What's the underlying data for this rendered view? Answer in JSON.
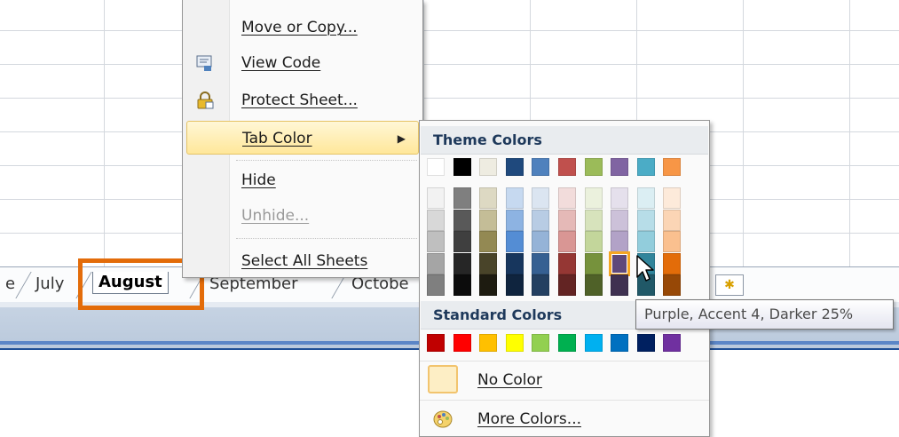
{
  "sheet_tabs": {
    "left_partial": "e",
    "july": "July",
    "august": "August",
    "september": "September",
    "october": "Octobe"
  },
  "context_menu": {
    "items": [
      {
        "label": "Move or Copy...",
        "icon": "",
        "state": "normal"
      },
      {
        "label": "View Code",
        "icon": "view-code-icon",
        "state": "normal"
      },
      {
        "label": "Protect Sheet...",
        "icon": "protect-sheet-icon",
        "state": "normal"
      },
      {
        "label": "Tab Color",
        "icon": "",
        "state": "highlighted",
        "submenu_arrow": "▶"
      },
      {
        "label": "Hide",
        "icon": "",
        "state": "normal"
      },
      {
        "label": "Unhide...",
        "icon": "",
        "state": "disabled"
      },
      {
        "label": "Select All Sheets",
        "icon": "",
        "state": "normal"
      }
    ]
  },
  "palette": {
    "theme_header": "Theme Colors",
    "standard_header": "Standard Colors",
    "theme_base": [
      "#ffffff",
      "#000000",
      "#eeece1",
      "#1f497d",
      "#4f81bd",
      "#c0504d",
      "#9bbb59",
      "#8064a2",
      "#4bacc6",
      "#f79646"
    ],
    "theme_shades": [
      [
        "#f2f2f2",
        "#7f7f7f",
        "#ddd9c3",
        "#c6d9f0",
        "#dbe5f1",
        "#f2dcdb",
        "#ebf1dd",
        "#e5e0ec",
        "#dbeef3",
        "#fdeada"
      ],
      [
        "#d8d8d8",
        "#595959",
        "#c4bd97",
        "#8db3e2",
        "#b8cce4",
        "#e5b9b7",
        "#d7e3bc",
        "#ccc1d9",
        "#b7dde8",
        "#fbd5b5"
      ],
      [
        "#bfbfbf",
        "#3f3f3f",
        "#938953",
        "#548dd4",
        "#95b3d7",
        "#d99694",
        "#c3d69b",
        "#b2a2c7",
        "#92cddc",
        "#fac08f"
      ],
      [
        "#a5a5a5",
        "#262626",
        "#494429",
        "#17365d",
        "#366092",
        "#953734",
        "#76923c",
        "#5f497a",
        "#31859b",
        "#e36c09"
      ],
      [
        "#7f7f7f",
        "#0c0c0c",
        "#1d1b10",
        "#0f243e",
        "#244061",
        "#632423",
        "#4f6128",
        "#3f3151",
        "#205867",
        "#974806"
      ]
    ],
    "selected_swatch": "#5f497a",
    "standard": [
      "#c00000",
      "#ff0000",
      "#ffc000",
      "#ffff00",
      "#92d050",
      "#00b050",
      "#00b0f0",
      "#0070c0",
      "#002060",
      "#7030a0"
    ],
    "no_color_label": "No Color",
    "more_colors_label": "More Colors..."
  },
  "tooltip": "Purple, Accent 4, Darker 25%",
  "colors": {
    "highlight_box": "#e36c0a",
    "menu_hover": "#ffe79a"
  }
}
